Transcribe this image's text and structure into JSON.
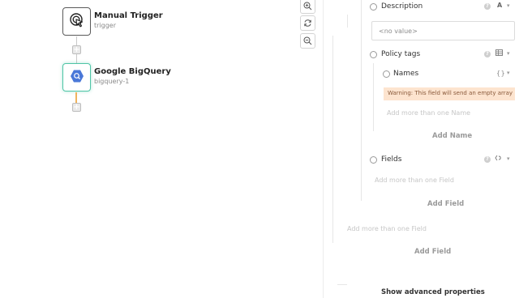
{
  "canvas": {
    "nodes": [
      {
        "title": "Manual Trigger",
        "subtitle": "trigger"
      },
      {
        "title": "Google BigQuery",
        "subtitle": "bigquery-1"
      }
    ],
    "zoom_controls": [
      "zoom-in",
      "reset-zoom",
      "zoom-out"
    ]
  },
  "panel": {
    "description": {
      "label": "Description",
      "value": "<no value>"
    },
    "policy_tags": {
      "label": "Policy tags",
      "names": {
        "label": "Names",
        "type_icon": "{ }",
        "warning": "Warning: This field will send an empty array",
        "placeholder": "Add more than one Name",
        "add_label": "Add Name"
      }
    },
    "fields": {
      "label": "Fields",
      "placeholder": "Add more than one Field",
      "add_label": "Add Field"
    },
    "outer_fields": {
      "placeholder": "Add more than one Field",
      "add_label": "Add Field"
    },
    "advanced_label": "Show advanced properties"
  },
  "colors": {
    "node_active_border": "#4fc5a6",
    "connector_active": "#f0b35c",
    "warning_bg": "#fde4cf",
    "bigquery_blue": "#4a78d8"
  }
}
